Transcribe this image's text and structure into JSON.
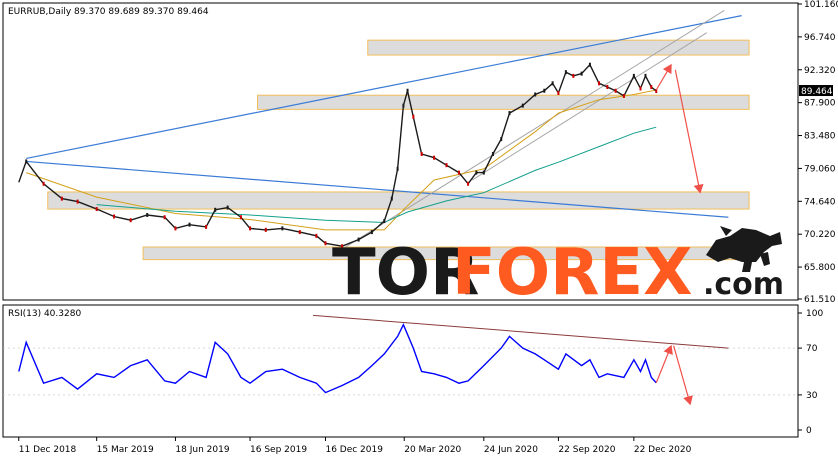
{
  "window": {
    "header": "EURRUB,Daily  89.370 89.689 89.370 89.464",
    "rsi_header": "RSI(13) 40.3280"
  },
  "watermark": {
    "tor": "TOR",
    "forex": "FOREX",
    "com": ".com",
    "logo_icon": "bull-bear-icon"
  },
  "colors": {
    "candle_up": "#1a1a1a",
    "candle_down": "#cc0000",
    "ma_fast": "#d4a017",
    "ma_slow": "#14a08c",
    "trend_line": "#3a7bd5",
    "channel_line": "#a6a6a6",
    "zone_fill": "#d9d9d9",
    "zone_border": "#f0b84a",
    "forecast_arrow": "#f0504a",
    "rsi_line": "#0000ff",
    "rsi_trend": "#8b3a3a",
    "price_tag_bg": "#000000",
    "logo_orange": "#ff5a1f"
  },
  "chart_data": {
    "type": "line",
    "symbol": "EURRUB",
    "timeframe": "Daily",
    "ohlc_last": {
      "open": 89.37,
      "high": 89.689,
      "low": 89.37,
      "close": 89.464
    },
    "current_price_label": "89.464",
    "price_axis_ticks": [
      "101.160",
      "96.740",
      "92.320",
      "87.900",
      "83.480",
      "79.060",
      "74.640",
      "70.220",
      "65.800",
      "61.510"
    ],
    "price_axis_values": [
      101.16,
      96.74,
      92.32,
      87.9,
      83.48,
      79.06,
      74.64,
      70.22,
      65.8,
      61.51
    ],
    "ylim": [
      61.51,
      101.16
    ],
    "x_ticks": [
      "11 Dec 2018",
      "15 Mar 2019",
      "18 Jun 2019",
      "16 Sep 2019",
      "16 Dec 2019",
      "20 Mar 2020",
      "24 Jun 2020",
      "22 Sep 2020",
      "22 Dec 2020"
    ],
    "price_series": [
      [
        "2018-12-11",
        77.2
      ],
      [
        "2018-12-20",
        80.0
      ],
      [
        "2019-01-10",
        77.0
      ],
      [
        "2019-02-01",
        75.0
      ],
      [
        "2019-02-20",
        74.6
      ],
      [
        "2019-03-15",
        73.6
      ],
      [
        "2019-04-05",
        72.6
      ],
      [
        "2019-04-25",
        72.1
      ],
      [
        "2019-05-15",
        72.8
      ],
      [
        "2019-06-05",
        72.5
      ],
      [
        "2019-06-18",
        71.0
      ],
      [
        "2019-07-05",
        71.5
      ],
      [
        "2019-07-25",
        71.2
      ],
      [
        "2019-08-05",
        73.5
      ],
      [
        "2019-08-20",
        73.8
      ],
      [
        "2019-09-05",
        72.5
      ],
      [
        "2019-09-16",
        71.0
      ],
      [
        "2019-10-05",
        70.8
      ],
      [
        "2019-10-25",
        71.0
      ],
      [
        "2019-11-15",
        70.5
      ],
      [
        "2019-12-05",
        70.0
      ],
      [
        "2019-12-16",
        69.0
      ],
      [
        "2020-01-05",
        68.6
      ],
      [
        "2020-01-25",
        69.5
      ],
      [
        "2020-02-10",
        70.5
      ],
      [
        "2020-02-25",
        72.0
      ],
      [
        "2020-03-05",
        75.0
      ],
      [
        "2020-03-12",
        79.0
      ],
      [
        "2020-03-19",
        87.5
      ],
      [
        "2020-03-24",
        89.5
      ],
      [
        "2020-03-31",
        86.0
      ],
      [
        "2020-04-10",
        81.0
      ],
      [
        "2020-04-25",
        80.5
      ],
      [
        "2020-05-10",
        79.5
      ],
      [
        "2020-05-25",
        78.5
      ],
      [
        "2020-06-05",
        77.0
      ],
      [
        "2020-06-15",
        78.5
      ],
      [
        "2020-06-24",
        78.5
      ],
      [
        "2020-07-05",
        81.0
      ],
      [
        "2020-07-15",
        83.0
      ],
      [
        "2020-07-25",
        86.5
      ],
      [
        "2020-08-10",
        87.5
      ],
      [
        "2020-08-25",
        89.0
      ],
      [
        "2020-09-05",
        89.5
      ],
      [
        "2020-09-15",
        90.5
      ],
      [
        "2020-09-22",
        89.2
      ],
      [
        "2020-10-01",
        92.0
      ],
      [
        "2020-10-10",
        91.5
      ],
      [
        "2020-10-20",
        91.8
      ],
      [
        "2020-10-30",
        93.0
      ],
      [
        "2020-11-10",
        90.5
      ],
      [
        "2020-11-20",
        90.0
      ],
      [
        "2020-11-30",
        89.5
      ],
      [
        "2020-12-10",
        88.8
      ],
      [
        "2020-12-22",
        91.5
      ],
      [
        "2020-12-30",
        89.8
      ],
      [
        "2021-01-05",
        91.5
      ],
      [
        "2021-01-12",
        90.0
      ],
      [
        "2021-01-18",
        89.464
      ]
    ],
    "ma_fast_series": [
      [
        "2018-12-20",
        78.5
      ],
      [
        "2019-03-15",
        75.2
      ],
      [
        "2019-06-18",
        73.0
      ],
      [
        "2019-09-16",
        72.2
      ],
      [
        "2019-12-16",
        70.8
      ],
      [
        "2020-02-25",
        70.8
      ],
      [
        "2020-03-19",
        73.5
      ],
      [
        "2020-04-25",
        77.5
      ],
      [
        "2020-06-24",
        79.0
      ],
      [
        "2020-08-25",
        84.0
      ],
      [
        "2020-09-22",
        86.5
      ],
      [
        "2020-11-10",
        88.3
      ],
      [
        "2020-12-22",
        89.0
      ],
      [
        "2021-01-18",
        89.6
      ]
    ],
    "ma_slow_series": [
      [
        "2019-03-15",
        74.2
      ],
      [
        "2019-06-18",
        73.3
      ],
      [
        "2019-09-16",
        72.8
      ],
      [
        "2019-12-16",
        72.1
      ],
      [
        "2020-02-25",
        71.8
      ],
      [
        "2020-03-24",
        73.2
      ],
      [
        "2020-05-10",
        74.7
      ],
      [
        "2020-06-24",
        75.8
      ],
      [
        "2020-08-25",
        78.8
      ],
      [
        "2020-09-22",
        79.9
      ],
      [
        "2020-11-10",
        82.0
      ],
      [
        "2020-12-22",
        83.8
      ],
      [
        "2021-01-18",
        84.6
      ]
    ],
    "zones": [
      {
        "x0": "2020-02-05",
        "x1": "2021-05-10",
        "y0": 94.3,
        "y1": 96.3
      },
      {
        "x0": "2019-09-25",
        "x1": "2021-05-10",
        "y0": 87.0,
        "y1": 88.9
      },
      {
        "x0": "2019-01-15",
        "x1": "2021-05-10",
        "y0": 73.6,
        "y1": 75.9
      },
      {
        "x0": "2019-05-10",
        "x1": "2021-05-10",
        "y0": 66.8,
        "y1": 68.5
      }
    ],
    "trend_lines": [
      {
        "x0": "2018-12-20",
        "y0": 80.4,
        "x1": "2021-05-01",
        "y1": 99.6
      },
      {
        "x0": "2018-12-20",
        "y0": 80.0,
        "x1": "2021-04-15",
        "y1": 72.5
      }
    ],
    "channel_lines": [
      {
        "x0": "2020-01-05",
        "y0": 68.2,
        "x1": "2021-04-10",
        "y1": 100.3
      },
      {
        "x0": "2020-06-10",
        "y0": 77.5,
        "x1": "2021-03-20",
        "y1": 97.3
      }
    ],
    "forecast_arrows": [
      {
        "x0": "2021-01-18",
        "y0": 89.6,
        "x1": "2021-02-05",
        "y1": 93.0
      },
      {
        "x0": "2021-02-10",
        "y0": 92.3,
        "x1": "2021-03-12",
        "y1": 75.8
      }
    ],
    "rsi": {
      "period": 13,
      "last_value": 40.328,
      "ylim": [
        0,
        100
      ],
      "ticks": [
        "100",
        "70",
        "30",
        "0"
      ],
      "tick_values": [
        100,
        70,
        30,
        0
      ],
      "series": [
        [
          "2018-12-11",
          50
        ],
        [
          "2018-12-20",
          75
        ],
        [
          "2019-01-10",
          40
        ],
        [
          "2019-02-01",
          45
        ],
        [
          "2019-02-20",
          35
        ],
        [
          "2019-03-15",
          48
        ],
        [
          "2019-04-05",
          45
        ],
        [
          "2019-04-25",
          55
        ],
        [
          "2019-05-15",
          60
        ],
        [
          "2019-06-05",
          42
        ],
        [
          "2019-06-18",
          40
        ],
        [
          "2019-07-05",
          50
        ],
        [
          "2019-07-25",
          45
        ],
        [
          "2019-08-05",
          75
        ],
        [
          "2019-08-20",
          65
        ],
        [
          "2019-09-05",
          45
        ],
        [
          "2019-09-16",
          40
        ],
        [
          "2019-10-05",
          50
        ],
        [
          "2019-10-25",
          52
        ],
        [
          "2019-11-15",
          45
        ],
        [
          "2019-12-05",
          40
        ],
        [
          "2019-12-16",
          32
        ],
        [
          "2020-01-05",
          38
        ],
        [
          "2020-01-25",
          45
        ],
        [
          "2020-02-10",
          55
        ],
        [
          "2020-02-25",
          65
        ],
        [
          "2020-03-12",
          80
        ],
        [
          "2020-03-19",
          90
        ],
        [
          "2020-03-31",
          70
        ],
        [
          "2020-04-10",
          50
        ],
        [
          "2020-04-25",
          48
        ],
        [
          "2020-05-10",
          45
        ],
        [
          "2020-05-25",
          40
        ],
        [
          "2020-06-05",
          42
        ],
        [
          "2020-06-24",
          55
        ],
        [
          "2020-07-15",
          70
        ],
        [
          "2020-07-25",
          80
        ],
        [
          "2020-08-10",
          70
        ],
        [
          "2020-08-25",
          65
        ],
        [
          "2020-09-05",
          60
        ],
        [
          "2020-09-22",
          52
        ],
        [
          "2020-10-01",
          65
        ],
        [
          "2020-10-20",
          55
        ],
        [
          "2020-10-30",
          60
        ],
        [
          "2020-11-10",
          45
        ],
        [
          "2020-11-20",
          48
        ],
        [
          "2020-12-10",
          45
        ],
        [
          "2020-12-22",
          60
        ],
        [
          "2020-12-30",
          50
        ],
        [
          "2021-01-05",
          60
        ],
        [
          "2021-01-12",
          45
        ],
        [
          "2021-01-18",
          40.328
        ]
      ],
      "trend_line": {
        "x0": "2019-12-01",
        "y0": 98,
        "x1": "2021-04-15",
        "y1": 70
      },
      "forecast_arrows": [
        {
          "x0": "2021-01-18",
          "y0": 40.3,
          "x1": "2021-02-05",
          "y1": 72
        },
        {
          "x0": "2021-02-08",
          "y0": 72,
          "x1": "2021-02-28",
          "y1": 22
        }
      ]
    }
  }
}
